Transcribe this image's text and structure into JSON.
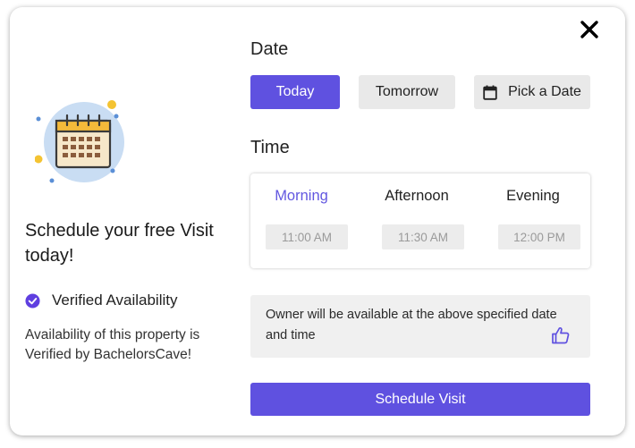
{
  "left": {
    "title": "Schedule your free Visit today!",
    "verified_label": "Verified Availability",
    "description": "Availability of this property is Verified by BachelorsCave!"
  },
  "date": {
    "label": "Date",
    "options": {
      "today": "Today",
      "tomorrow": "Tomorrow",
      "pick": "Pick a Date"
    },
    "selected": "Today"
  },
  "time": {
    "label": "Time",
    "tabs": {
      "morning": "Morning",
      "afternoon": "Afternoon",
      "evening": "Evening"
    },
    "slots": {
      "morning": "11:00 AM",
      "afternoon": "11:30 AM",
      "evening": "12:00 PM"
    },
    "selected": "Morning"
  },
  "info": {
    "text": "Owner will be available at the above specified date and time"
  },
  "actions": {
    "schedule_label": "Schedule Visit"
  },
  "colors": {
    "accent": "#5f51e0",
    "secondary_button": "#e9e9e9",
    "info_background": "#f0f0f0"
  },
  "icons": {
    "close": "close-icon",
    "illustration": "calendar-illustration-icon",
    "verified": "check-circle-icon",
    "pick_date": "calendar-icon",
    "thumb": "thumbs-up-icon"
  }
}
